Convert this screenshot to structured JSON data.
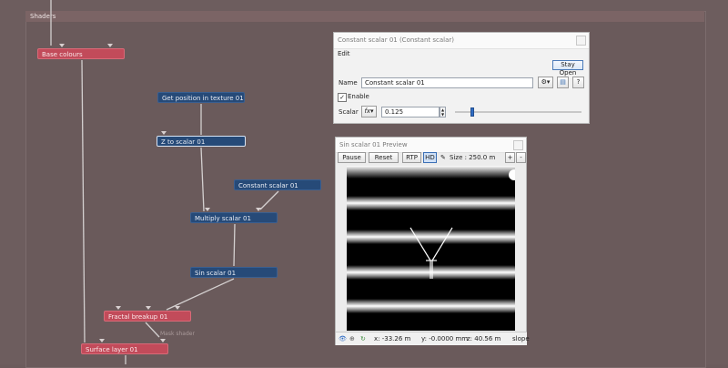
{
  "panel": {
    "title": "Shaders"
  },
  "nodes": {
    "base_colours": "Base colours",
    "get_position": "Get position in texture 01",
    "z_to_scalar": "Z to scalar 01",
    "constant_scalar": "Constant scalar 01",
    "multiply_scalar": "Multiply scalar 01",
    "sin_scalar": "Sin scalar 01",
    "fractal_breakup": "Fractal breakup 01",
    "surface_layer": "Surface layer 01",
    "ghost_mask": "Mask shader"
  },
  "editor": {
    "title": "Constant scalar 01    (Constant scalar)",
    "menu_edit": "Edit",
    "stay_open": "Stay Open",
    "name_label": "Name",
    "name_value": "Constant scalar 01",
    "enable_label": "Enable",
    "enable_checked": true,
    "scalar_label": "Scalar",
    "scalar_value": "0.125",
    "slider_fraction": 0.125
  },
  "preview": {
    "title": "Sin scalar 01 Preview",
    "pause": "Pause",
    "reset": "Reset",
    "rtp": "RTP",
    "hd": "HD",
    "size_text": "Size : 250.0 m",
    "plus": "+",
    "minus": "-",
    "x_text": "x: -33.26 m",
    "y_text": "y: -0.0000 mm",
    "z_text": "z: 40.56 m",
    "slope_text": "slope"
  },
  "colors": {
    "node_red": "#c24b5a",
    "node_blue": "#264a78",
    "background": "#6d5d5e"
  }
}
